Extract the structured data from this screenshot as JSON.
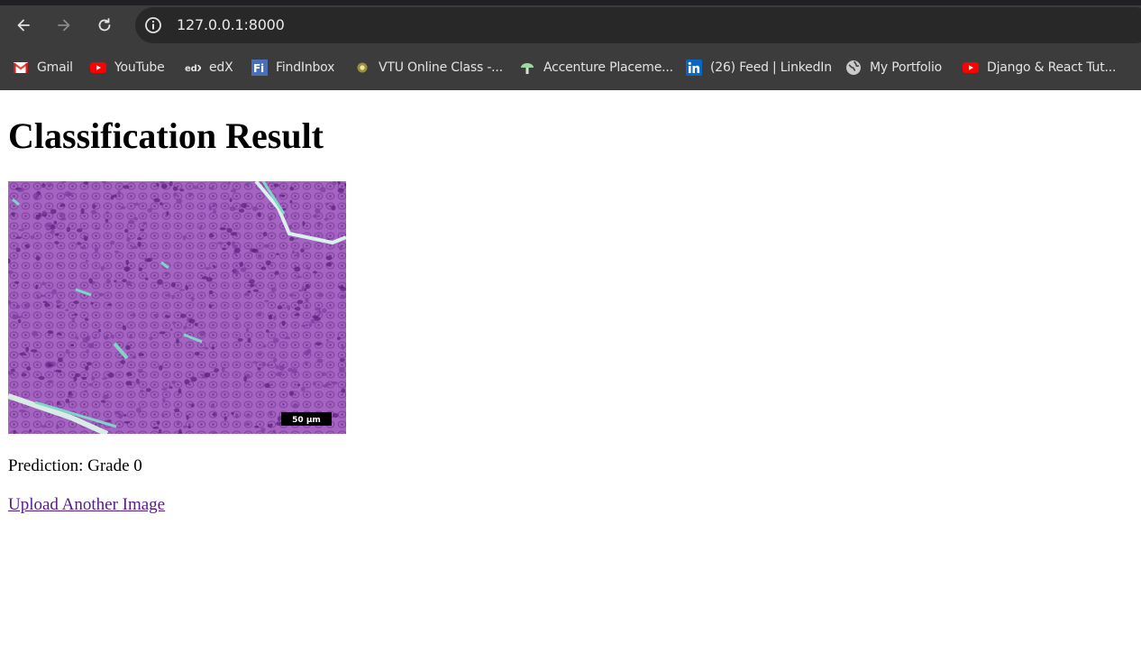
{
  "browser": {
    "url": "127.0.0.1:8000",
    "colors": {
      "frame": "#3c3c3c",
      "omnibox": "#282828",
      "text": "#e3e3e3"
    }
  },
  "bookmarks": [
    {
      "label": "Gmail",
      "icon": "gmail-icon"
    },
    {
      "label": "YouTube",
      "icon": "youtube-icon"
    },
    {
      "label": "edX",
      "icon": "edx-icon"
    },
    {
      "label": "FindInbox",
      "icon": "findinbox-icon"
    },
    {
      "label": "VTU Online Class -...",
      "icon": "vtu-icon"
    },
    {
      "label": "Accenture Placeme...",
      "icon": "accenture-icon"
    },
    {
      "label": "(26) Feed | LinkedIn",
      "icon": "linkedin-icon"
    },
    {
      "label": "My Portfolio",
      "icon": "globe-icon"
    },
    {
      "label": "Django & React Tut...",
      "icon": "youtube-icon"
    }
  ],
  "page": {
    "title": "Classification Result",
    "image": {
      "scale_bar": "50 µm"
    },
    "prediction": "Prediction: Grade 0",
    "upload_link": "Upload Another Image",
    "colors": {
      "link": "#551a8b",
      "tissue": "#a564c1",
      "stroma": "#7fd6c8"
    }
  }
}
